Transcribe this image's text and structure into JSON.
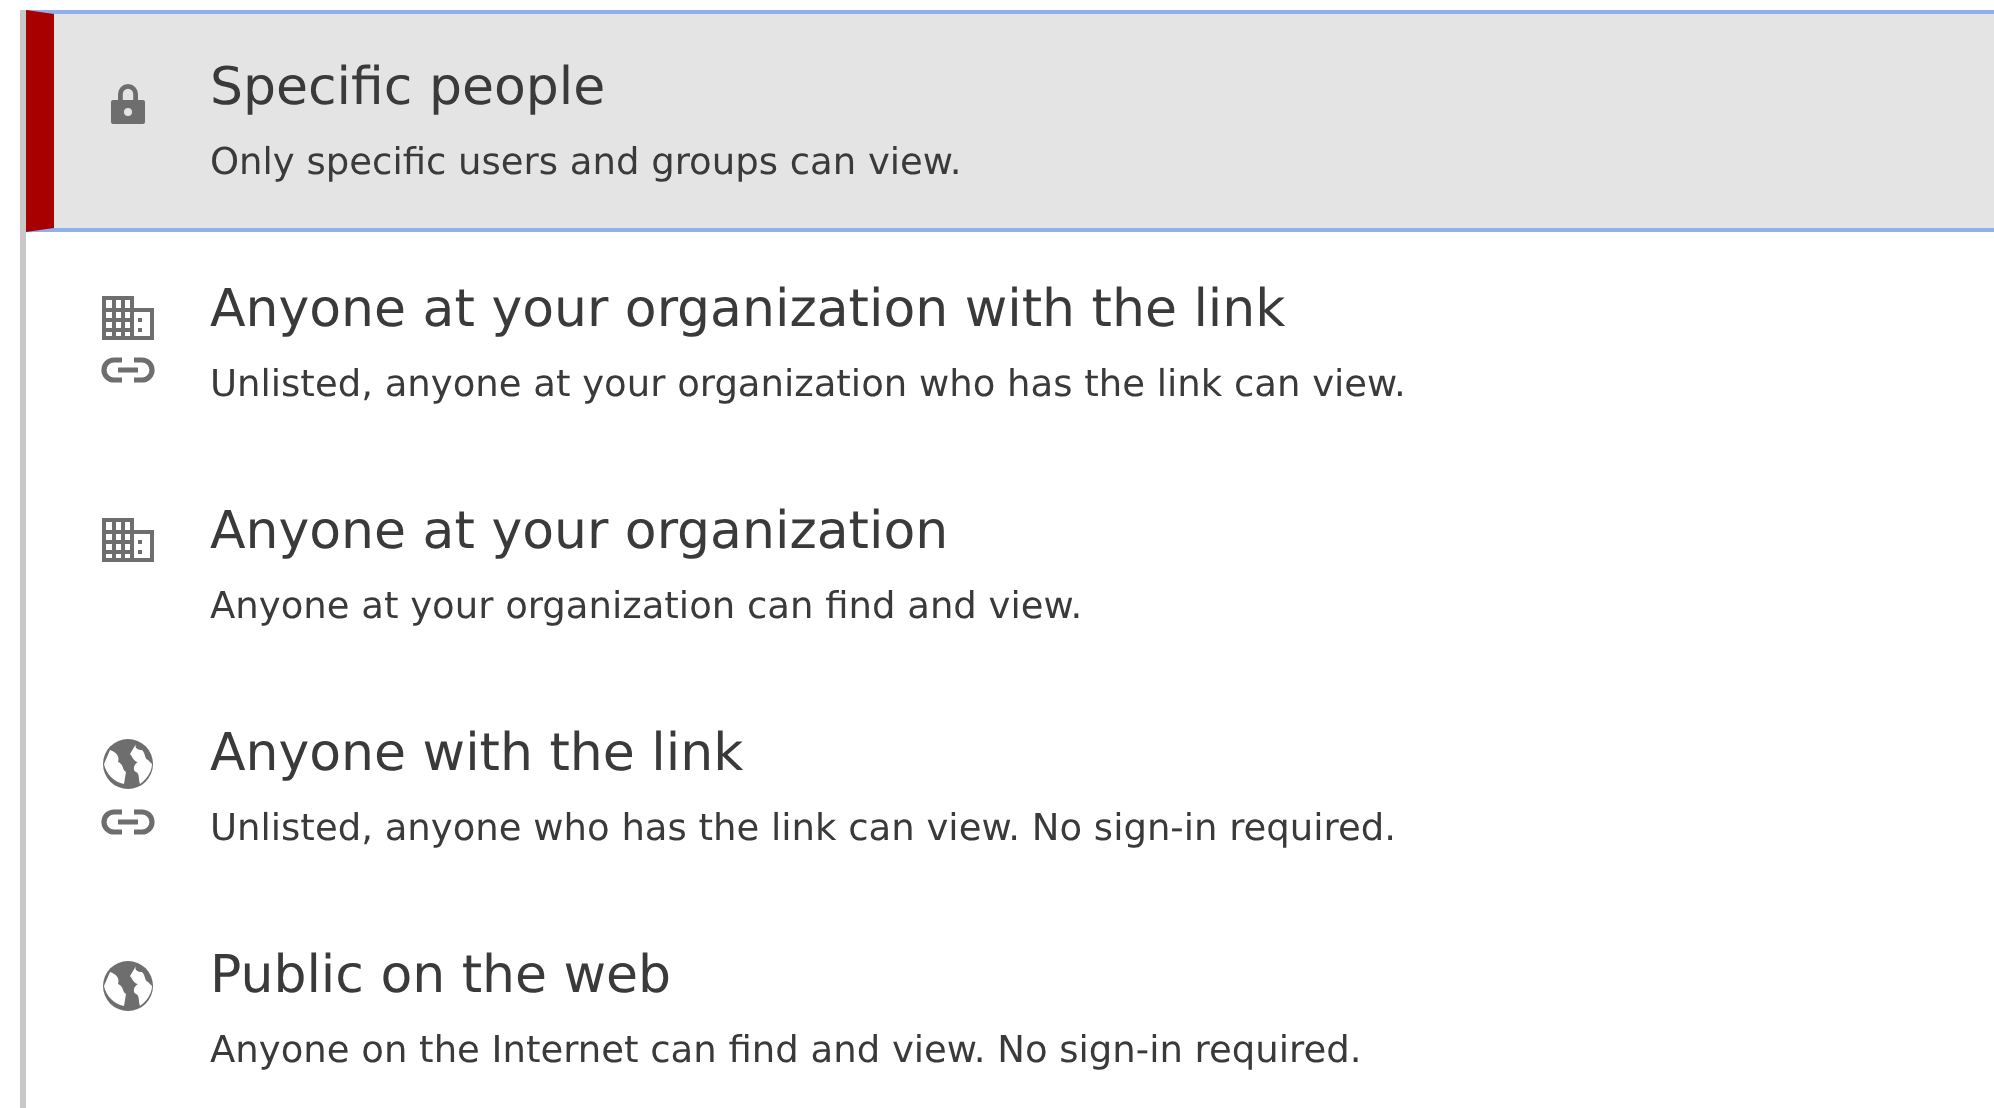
{
  "options": [
    {
      "kind": "lock",
      "title": "Specific people",
      "description": "Only specific users and groups can view.",
      "selected": true
    },
    {
      "kind": "org-link",
      "title": "Anyone at your organization with the link",
      "description": "Unlisted, anyone at your organization who has the link can view.",
      "selected": false
    },
    {
      "kind": "org",
      "title": "Anyone at your organization",
      "description": "Anyone at your organization can find and view.",
      "selected": false
    },
    {
      "kind": "globe-link",
      "title": "Anyone with the link",
      "description": "Unlisted, anyone who has the link can view. No sign-in required.",
      "selected": false
    },
    {
      "kind": "globe",
      "title": "Public on the web",
      "description": "Anyone on the Internet can find and view. No sign-in required.",
      "selected": false
    }
  ]
}
